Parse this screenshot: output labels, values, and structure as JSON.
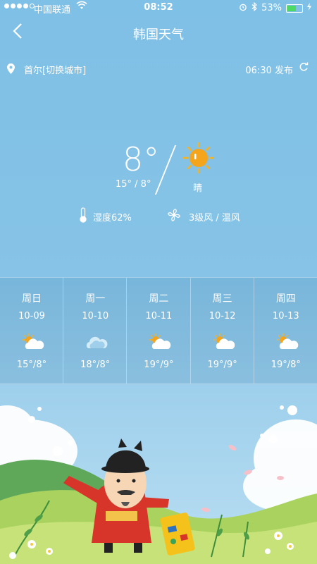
{
  "status_bar": {
    "carrier": "中国联通",
    "time": "08:52",
    "battery": "53%",
    "battery_level": 0.53
  },
  "header": {
    "title": "韩国天气"
  },
  "location": {
    "city": "首尔[切换城市]",
    "published": "06:30 发布"
  },
  "current": {
    "temp": "8°",
    "range": "15° / 8°",
    "condition": "晴",
    "humidity": "湿度62%",
    "wind": "3级风 / 温风"
  },
  "forecast": [
    {
      "day": "周日",
      "date": "10-09",
      "icon": "partly-cloudy-icon",
      "range": "15°/8°"
    },
    {
      "day": "周一",
      "date": "10-10",
      "icon": "cloudy-icon",
      "range": "18°/8°"
    },
    {
      "day": "周二",
      "date": "10-11",
      "icon": "partly-cloudy-icon",
      "range": "19°/9°"
    },
    {
      "day": "周三",
      "date": "10-12",
      "icon": "partly-cloudy-icon",
      "range": "19°/9°"
    },
    {
      "day": "周四",
      "date": "10-13",
      "icon": "partly-cloudy-icon",
      "range": "19°/8°"
    }
  ]
}
